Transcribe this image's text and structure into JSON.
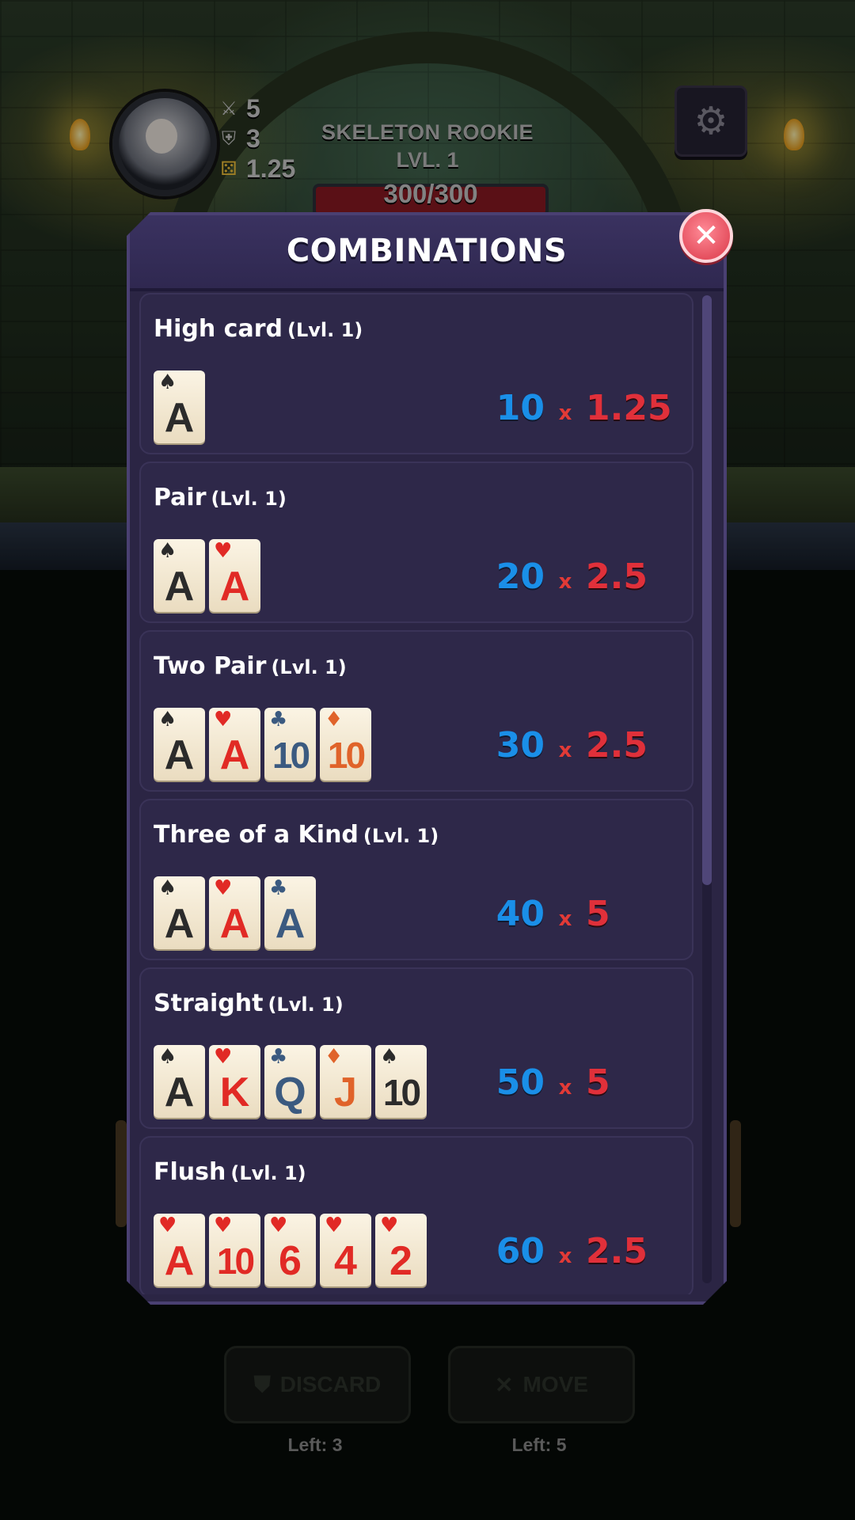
{
  "hud": {
    "stats": [
      {
        "icon": "sword-icon",
        "value": "5"
      },
      {
        "icon": "shield-icon",
        "value": "3"
      },
      {
        "icon": "die-icon",
        "value": "1.25"
      }
    ],
    "enemy": {
      "name": "SKELETON ROOKIE",
      "level": "LVL. 1",
      "hp": "300/300",
      "hp_fraction": 1.0
    },
    "settings_icon": "gear-icon"
  },
  "modal": {
    "title": "COMBINATIONS",
    "close_icon": "close-icon",
    "combinations": [
      {
        "name": "High card",
        "level": "(Lvl. 1)",
        "chips": "10",
        "times": "x",
        "mult": "1.25",
        "cards": [
          {
            "suit": "♠",
            "suit_name": "spade",
            "rank": "A"
          }
        ]
      },
      {
        "name": "Pair",
        "level": "(Lvl. 1)",
        "chips": "20",
        "times": "x",
        "mult": "2.5",
        "cards": [
          {
            "suit": "♠",
            "suit_name": "spade",
            "rank": "A"
          },
          {
            "suit": "♥",
            "suit_name": "heart",
            "rank": "A"
          }
        ]
      },
      {
        "name": "Two Pair",
        "level": "(Lvl. 1)",
        "chips": "30",
        "times": "x",
        "mult": "2.5",
        "cards": [
          {
            "suit": "♠",
            "suit_name": "spade",
            "rank": "A"
          },
          {
            "suit": "♥",
            "suit_name": "heart",
            "rank": "A"
          },
          {
            "suit": "♣",
            "suit_name": "club",
            "rank": "10"
          },
          {
            "suit": "♦",
            "suit_name": "diamond",
            "rank": "10"
          }
        ]
      },
      {
        "name": "Three of a Kind",
        "level": "(Lvl. 1)",
        "chips": "40",
        "times": "x",
        "mult": "5",
        "cards": [
          {
            "suit": "♠",
            "suit_name": "spade",
            "rank": "A"
          },
          {
            "suit": "♥",
            "suit_name": "heart",
            "rank": "A"
          },
          {
            "suit": "♣",
            "suit_name": "club",
            "rank": "A"
          }
        ]
      },
      {
        "name": "Straight",
        "level": "(Lvl. 1)",
        "chips": "50",
        "times": "x",
        "mult": "5",
        "cards": [
          {
            "suit": "♠",
            "suit_name": "spade",
            "rank": "A"
          },
          {
            "suit": "♥",
            "suit_name": "heart",
            "rank": "K"
          },
          {
            "suit": "♣",
            "suit_name": "club",
            "rank": "Q"
          },
          {
            "suit": "♦",
            "suit_name": "diamond",
            "rank": "J"
          },
          {
            "suit": "♠",
            "suit_name": "spade",
            "rank": "10"
          }
        ]
      },
      {
        "name": "Flush",
        "level": "(Lvl. 1)",
        "chips": "60",
        "times": "x",
        "mult": "2.5",
        "cards": [
          {
            "suit": "♥",
            "suit_name": "heart",
            "rank": "A"
          },
          {
            "suit": "♥",
            "suit_name": "heart",
            "rank": "10"
          },
          {
            "suit": "♥",
            "suit_name": "heart",
            "rank": "6"
          },
          {
            "suit": "♥",
            "suit_name": "heart",
            "rank": "4"
          },
          {
            "suit": "♥",
            "suit_name": "heart",
            "rank": "2"
          }
        ]
      }
    ]
  },
  "bottom": {
    "discard": {
      "label": "DISCARD",
      "icon": "discard-icon",
      "left": "Left: 3"
    },
    "move": {
      "label": "MOVE",
      "icon": "move-icon",
      "left": "Left: 5"
    }
  },
  "colors": {
    "chips": "#1a8fe8",
    "mult": "#e0303a",
    "panel": "#2b2544"
  }
}
